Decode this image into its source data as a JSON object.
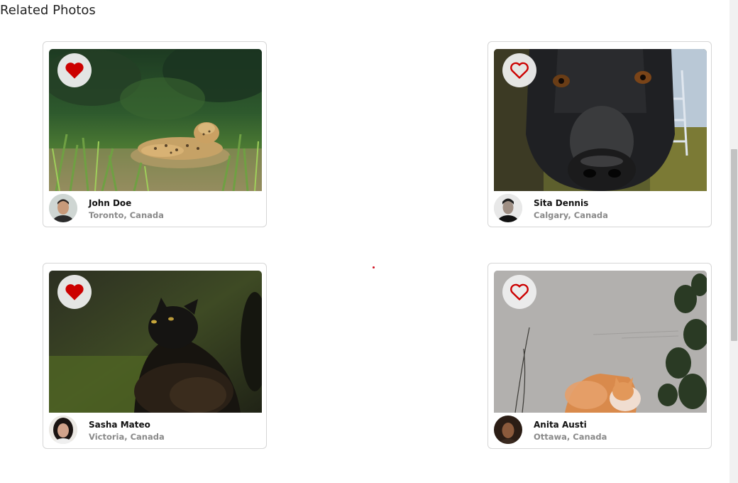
{
  "section": {
    "title": "Related Photos"
  },
  "accent_color": "#cc0000",
  "cards": [
    {
      "name": "John Doe",
      "location": "Toronto, Canada",
      "liked": true,
      "photo": "jaguar-photo"
    },
    {
      "name": "Sita Dennis",
      "location": "Calgary, Canada",
      "liked": false,
      "photo": "black-dog-photo"
    },
    {
      "name": "Sasha Mateo",
      "location": "Victoria, Canada",
      "liked": true,
      "photo": "black-cat-photo"
    },
    {
      "name": "Anita Austi",
      "location": "Ottawa, Canada",
      "liked": false,
      "photo": "orange-cat-photo"
    }
  ]
}
